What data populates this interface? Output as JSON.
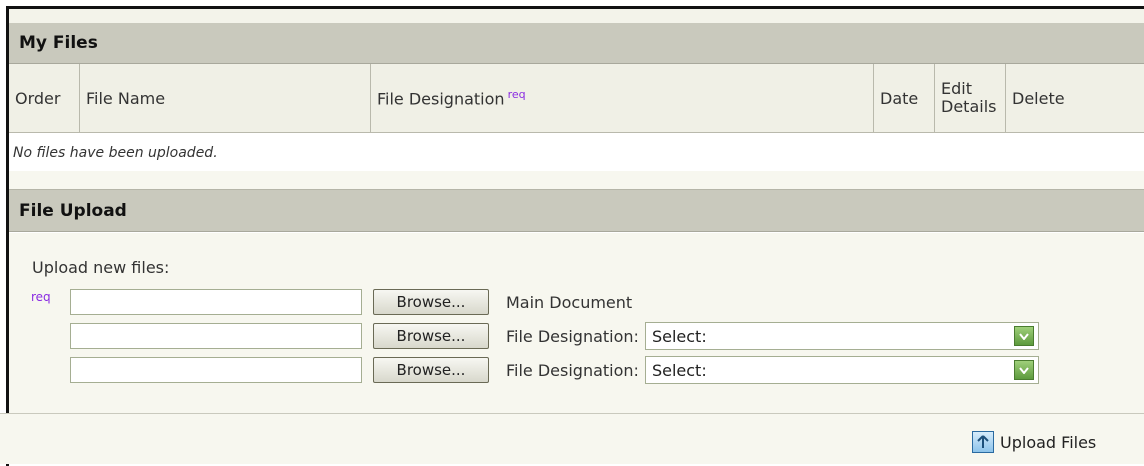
{
  "my_files": {
    "title": "My Files",
    "columns": [
      "Order",
      "File Name",
      "File Designation",
      "Date",
      "Edit Details",
      "Delete"
    ],
    "req_marker": "req",
    "empty_message": "No files have been uploaded."
  },
  "file_upload": {
    "title": "File Upload",
    "upload_label": "Upload new files:",
    "req_marker": "req",
    "rows": [
      {
        "browse_label": "Browse...",
        "text": "Main Document"
      },
      {
        "browse_label": "Browse...",
        "text": "File Designation:",
        "select_value": "Select:"
      },
      {
        "browse_label": "Browse...",
        "text": "File Designation:",
        "select_value": "Select:"
      }
    ],
    "upload_button_label": "Upload Files"
  },
  "icons": {
    "select_dropdown": "chevron-down-icon",
    "upload": "upload-arrow-icon"
  },
  "colors": {
    "section_header_bg": "#c9c9bd",
    "panel_bg": "#f7f7ef",
    "req_color": "#8a2be2",
    "dropdown_green": "#5d9a3d"
  }
}
